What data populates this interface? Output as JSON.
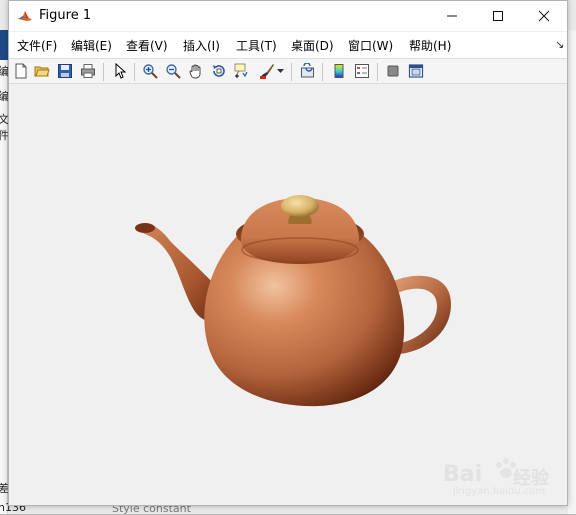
{
  "window": {
    "title": "Figure 1",
    "minimize_glyph": "—",
    "maximize_glyph": "☐",
    "close_glyph": "✕"
  },
  "menu": {
    "items": [
      {
        "label": "文件(F)"
      },
      {
        "label": "编辑(E)"
      },
      {
        "label": "查看(V)"
      },
      {
        "label": "插入(I)"
      },
      {
        "label": "工具(T)"
      },
      {
        "label": "桌面(D)"
      },
      {
        "label": "窗口(W)"
      },
      {
        "label": "帮助(H)"
      }
    ],
    "overflow_glyph": "↘"
  },
  "toolbar": {
    "icons": [
      "new-figure-icon",
      "open-file-icon",
      "save-icon",
      "print-icon",
      "edit-plot-arrow-icon",
      "zoom-in-icon",
      "zoom-out-icon",
      "pan-hand-icon",
      "rotate-3d-icon",
      "data-cursor-icon",
      "brush-icon",
      "link-plot-icon",
      "colorbar-icon",
      "legend-icon",
      "hide-plot-tools-icon",
      "show-plot-tools-icon"
    ]
  },
  "figure": {
    "object": "teapot",
    "colors": {
      "body": "#b5653d",
      "highlight": "#f2c3a0",
      "shadow": "#3a1608",
      "knob": "#d9b26a",
      "canvas": "#f0f0f0"
    }
  },
  "background": {
    "left_fragments": [
      "编",
      "编",
      "文件",
      "差",
      "n136"
    ],
    "bottom_fragment": "Style   constant"
  },
  "watermark": {
    "brand": "Bai",
    "paw": "du",
    "chinese": "经验",
    "url": "jingyan.baidu.com"
  }
}
